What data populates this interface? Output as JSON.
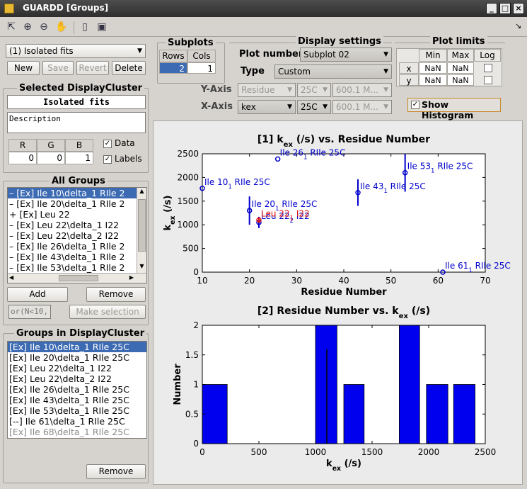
{
  "window": {
    "title": "GUARDD [Groups]"
  },
  "toolbar": {
    "icons": [
      "select-icon",
      "zoom-in-icon",
      "zoom-out-icon",
      "pan-icon",
      "new-figure-icon",
      "save-icon"
    ],
    "corner": "↘"
  },
  "cluster_select": {
    "value": "(1) Isolated fits"
  },
  "cluster_buttons": {
    "new": "New",
    "save": "Save",
    "revert": "Revert",
    "delete": "Delete"
  },
  "selected_cluster": {
    "legend": "Selected DisplayCluster",
    "name": "Isolated fits",
    "description": "Description",
    "rgb_headers": [
      "R",
      "G",
      "B"
    ],
    "rgb_values": [
      "0",
      "0",
      "1"
    ],
    "data_label": "Data",
    "labels_label": "Labels",
    "data_checked": true,
    "labels_checked": true
  },
  "all_groups": {
    "legend": "All Groups",
    "items": [
      "– [Ex] Ile 10\\delta_1 RIle 2",
      "– [Ex] Ile 20\\delta_1 RIle 2",
      "+ [Ex] Leu 22",
      "– [Ex] Leu 22\\delta_1 I22",
      "– [Ex] Leu 22\\delta_2 I22",
      "– [Ex] Ile 26\\delta_1 RIle 2",
      "– [Ex] Ile 43\\delta_1 RIle 2",
      "– [Ex] Ile 53\\delta_1 RIle 2"
    ],
    "selected_index": 0,
    "add": "Add",
    "remove": "Remove",
    "filter": "or(N<10,",
    "make_selection": "Make selection"
  },
  "groups_in_cluster": {
    "legend": "Groups in DisplayCluster",
    "items": [
      "[Ex] Ile 10\\delta_1 RIle 25C",
      "[Ex] Ile 20\\delta_1 RIle 25C",
      "[Ex] Leu 22\\delta_1 I22",
      "[Ex] Leu 22\\delta_2 I22",
      "[Ex] Ile 26\\delta_1 RIle 25C",
      "[Ex] Ile 43\\delta_1 RIle 25C",
      "[Ex] Ile 53\\delta_1 RIle 25C",
      "[--] Ile 61\\delta_1 RIle 25C",
      "[Ex] Ile 68\\delta_1 RIle 25C"
    ],
    "selected_index": 0,
    "greyed_index": 8,
    "remove": "Remove"
  },
  "subplots": {
    "legend": "Subplots",
    "rows_label": "Rows",
    "cols_label": "Cols",
    "rows": "2",
    "cols": "1"
  },
  "display_settings": {
    "legend": "Display settings",
    "plot_number_label": "Plot number",
    "plot_number": "Subplot 02",
    "type_label": "Type",
    "type": "Custom",
    "yaxis_label": "Y-Axis",
    "y_param": "Residue",
    "y_temp": "25C",
    "y_field": "600.1 M...",
    "xaxis_label": "X-Axis",
    "x_param": "kex",
    "x_temp": "25C",
    "x_field": "600.1 M..."
  },
  "plot_limits": {
    "legend": "Plot limits",
    "headers": [
      "Min",
      "Max",
      "Log"
    ],
    "rows": [
      {
        "axis": "x",
        "min": "NaN",
        "max": "NaN"
      },
      {
        "axis": "y",
        "min": "NaN",
        "max": "NaN"
      }
    ],
    "show_histogram": "Show Histogram",
    "show_histogram_checked": true
  },
  "chart_data": [
    {
      "type": "scatter",
      "title_main": "[1] k",
      "title_sub": "ex",
      "title_rest": " (/s) vs. Residue Number",
      "xlabel": "Residue Number",
      "ylabel_main": "k",
      "ylabel_sub": "ex",
      "ylabel_rest": " (/s)",
      "xlim": [
        10,
        70
      ],
      "ylim": [
        0,
        2500
      ],
      "xticks": [
        "10",
        "20",
        "30",
        "40",
        "50",
        "60",
        "70"
      ],
      "yticks": [
        "0",
        "500",
        "1000",
        "1500",
        "2000",
        "2500"
      ],
      "points": [
        {
          "x": 10,
          "y": 1770,
          "err": 0,
          "label": "Ile 10",
          "lsub": "1",
          "lrest": " RIle 25C",
          "color": "#0000cc"
        },
        {
          "x": 20,
          "y": 1300,
          "err": 300,
          "label": "Ile 20",
          "lsub": "1",
          "lrest": " RIle 25C",
          "color": "#0000cc"
        },
        {
          "x": 22,
          "y": 1050,
          "err": 120,
          "label": "Leu 22",
          "lsub": "2",
          "lrest": " I22",
          "color": "#0000cc"
        },
        {
          "x": 22,
          "y": 1100,
          "err": 40,
          "label": "Leu 22",
          "lsub": "1",
          "lrest": " I22",
          "color": "#e01010"
        },
        {
          "x": 26,
          "y": 2390,
          "err": 0,
          "label": "Ile 26",
          "lsub": "1",
          "lrest": " RIle 25C",
          "color": "#0000cc"
        },
        {
          "x": 43,
          "y": 1680,
          "err": 280,
          "label": "Ile 43",
          "lsub": "1",
          "lrest": " RIle 25C",
          "color": "#0000cc"
        },
        {
          "x": 53,
          "y": 2100,
          "err": 400,
          "label": "Ile 53",
          "lsub": "1",
          "lrest": " RIle 25C",
          "color": "#0000cc"
        },
        {
          "x": 61,
          "y": 0,
          "err": 0,
          "label": "Ile 61",
          "lsub": "1",
          "lrest": " RIle 25C",
          "color": "#0000cc"
        }
      ]
    },
    {
      "type": "bar",
      "title_main": "[2] Residue Number vs. k",
      "title_sub": "ex",
      "title_rest": " (/s)",
      "xlabel_main": "k",
      "xlabel_sub": "ex",
      "xlabel_rest": " (/s)",
      "ylabel": "Number",
      "xlim": [
        0,
        2500
      ],
      "ylim": [
        0,
        2
      ],
      "xticks": [
        "0",
        "500",
        "1000",
        "1500",
        "2000",
        "2500"
      ],
      "yticks": [
        "0",
        "0.5",
        "1",
        "1.5",
        "2"
      ],
      "bins": [
        {
          "from": 0,
          "to": 220,
          "count": 1
        },
        {
          "from": 1000,
          "to": 1190,
          "count": 2
        },
        {
          "from": 1250,
          "to": 1430,
          "count": 1
        },
        {
          "from": 1740,
          "to": 1920,
          "count": 2
        },
        {
          "from": 1980,
          "to": 2170,
          "count": 1
        },
        {
          "from": 2220,
          "to": 2410,
          "count": 1
        }
      ],
      "marker_x": 1100,
      "bar_color": "#0000ee"
    }
  ]
}
